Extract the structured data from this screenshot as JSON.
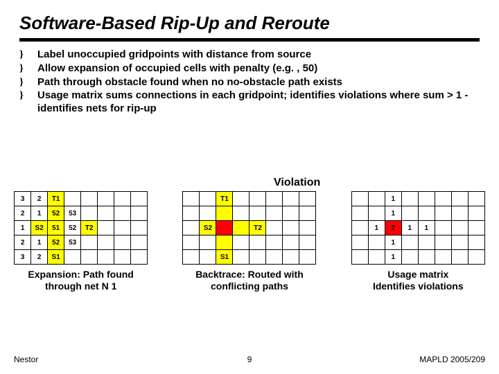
{
  "title": "Software-Based Rip-Up and Reroute",
  "bullets": [
    "Label unoccupied gridpoints with distance from source",
    "Allow expansion of occupied cells with penalty (e.g. , 50)",
    "Path through obstacle found when no no-obstacle path exists",
    "Usage matrix sums connections in each gridpoint; identifies violations where sum > 1 - identifies nets for rip-up"
  ],
  "bullet_mark": "}",
  "violation_label": "Violation",
  "grids": {
    "left": {
      "rows": [
        [
          {
            "t": "3"
          },
          {
            "t": "2"
          },
          {
            "t": "T1",
            "c": "y"
          },
          {
            "t": ""
          },
          {
            "t": ""
          },
          {
            "t": ""
          },
          {
            "t": ""
          },
          {
            "t": ""
          }
        ],
        [
          {
            "t": "2"
          },
          {
            "t": "1"
          },
          {
            "t": "52",
            "c": "y"
          },
          {
            "t": "53"
          },
          {
            "t": ""
          },
          {
            "t": ""
          },
          {
            "t": ""
          },
          {
            "t": ""
          }
        ],
        [
          {
            "t": "1"
          },
          {
            "t": "S2",
            "c": "y"
          },
          {
            "t": "51",
            "c": "y"
          },
          {
            "t": "52"
          },
          {
            "t": "T2",
            "c": "y"
          },
          {
            "t": ""
          },
          {
            "t": ""
          },
          {
            "t": ""
          }
        ],
        [
          {
            "t": "2"
          },
          {
            "t": "1"
          },
          {
            "t": "52",
            "c": "y"
          },
          {
            "t": "53"
          },
          {
            "t": ""
          },
          {
            "t": ""
          },
          {
            "t": ""
          },
          {
            "t": ""
          }
        ],
        [
          {
            "t": "3"
          },
          {
            "t": "2"
          },
          {
            "t": "S1",
            "c": "y"
          },
          {
            "t": ""
          },
          {
            "t": ""
          },
          {
            "t": ""
          },
          {
            "t": ""
          },
          {
            "t": ""
          }
        ]
      ],
      "caption_l1": "Expansion: Path found",
      "caption_l2": "through net N 1"
    },
    "middle": {
      "rows": [
        [
          {
            "t": ""
          },
          {
            "t": ""
          },
          {
            "t": "T1",
            "c": "y"
          },
          {
            "t": ""
          },
          {
            "t": ""
          },
          {
            "t": ""
          },
          {
            "t": ""
          },
          {
            "t": ""
          }
        ],
        [
          {
            "t": ""
          },
          {
            "t": ""
          },
          {
            "t": "",
            "c": "y"
          },
          {
            "t": ""
          },
          {
            "t": ""
          },
          {
            "t": ""
          },
          {
            "t": ""
          },
          {
            "t": ""
          }
        ],
        [
          {
            "t": ""
          },
          {
            "t": "S2",
            "c": "y"
          },
          {
            "t": "",
            "c": "r"
          },
          {
            "t": "",
            "c": "y"
          },
          {
            "t": "T2",
            "c": "y"
          },
          {
            "t": ""
          },
          {
            "t": ""
          },
          {
            "t": ""
          }
        ],
        [
          {
            "t": ""
          },
          {
            "t": ""
          },
          {
            "t": "",
            "c": "y"
          },
          {
            "t": ""
          },
          {
            "t": ""
          },
          {
            "t": ""
          },
          {
            "t": ""
          },
          {
            "t": ""
          }
        ],
        [
          {
            "t": ""
          },
          {
            "t": ""
          },
          {
            "t": "S1",
            "c": "y"
          },
          {
            "t": ""
          },
          {
            "t": ""
          },
          {
            "t": ""
          },
          {
            "t": ""
          },
          {
            "t": ""
          }
        ]
      ],
      "caption_l1": "Backtrace: Routed with",
      "caption_l2": "conflicting paths"
    },
    "right": {
      "rows": [
        [
          {
            "t": ""
          },
          {
            "t": ""
          },
          {
            "t": "1"
          },
          {
            "t": ""
          },
          {
            "t": ""
          },
          {
            "t": ""
          },
          {
            "t": ""
          },
          {
            "t": ""
          }
        ],
        [
          {
            "t": ""
          },
          {
            "t": ""
          },
          {
            "t": "1"
          },
          {
            "t": ""
          },
          {
            "t": ""
          },
          {
            "t": ""
          },
          {
            "t": ""
          },
          {
            "t": ""
          }
        ],
        [
          {
            "t": ""
          },
          {
            "t": "1"
          },
          {
            "t": "2",
            "c": "r"
          },
          {
            "t": "1"
          },
          {
            "t": "1"
          },
          {
            "t": ""
          },
          {
            "t": ""
          },
          {
            "t": ""
          }
        ],
        [
          {
            "t": ""
          },
          {
            "t": ""
          },
          {
            "t": "1"
          },
          {
            "t": ""
          },
          {
            "t": ""
          },
          {
            "t": ""
          },
          {
            "t": ""
          },
          {
            "t": ""
          }
        ],
        [
          {
            "t": ""
          },
          {
            "t": ""
          },
          {
            "t": "1"
          },
          {
            "t": ""
          },
          {
            "t": ""
          },
          {
            "t": ""
          },
          {
            "t": ""
          },
          {
            "t": ""
          }
        ]
      ],
      "caption_l1": "Usage matrix",
      "caption_l2": "Identifies violations"
    }
  },
  "footer": {
    "left": "Nestor",
    "page": "9",
    "right": "MAPLD 2005/209"
  }
}
